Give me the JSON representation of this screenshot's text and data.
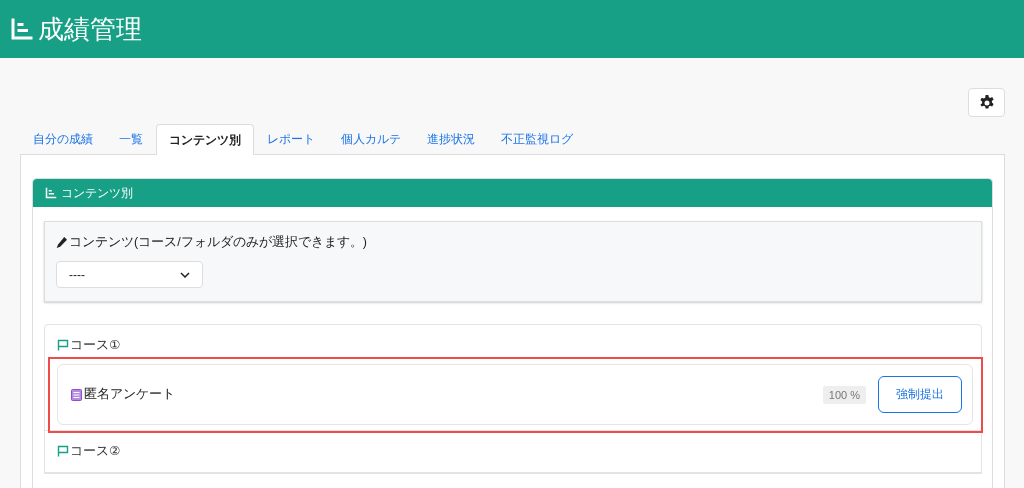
{
  "header": {
    "title": "成績管理"
  },
  "tabs": [
    {
      "label": "自分の成績",
      "selected": false
    },
    {
      "label": "一覧",
      "selected": false
    },
    {
      "label": "コンテンツ別",
      "selected": true
    },
    {
      "label": "レポート",
      "selected": false
    },
    {
      "label": "個人カルテ",
      "selected": false
    },
    {
      "label": "進捗状況",
      "selected": false
    },
    {
      "label": "不正監視ログ",
      "selected": false
    }
  ],
  "card": {
    "title": "コンテンツ別",
    "filter": {
      "label": "コンテンツ(コース/フォルダのみが選択できます。)",
      "value": "----"
    },
    "courses": [
      {
        "name": "コース①",
        "items": [
          {
            "name": "匿名アンケート",
            "progress": "100 %",
            "button": "強制提出",
            "highlighted": true
          }
        ]
      },
      {
        "name": "コース②"
      }
    ]
  }
}
